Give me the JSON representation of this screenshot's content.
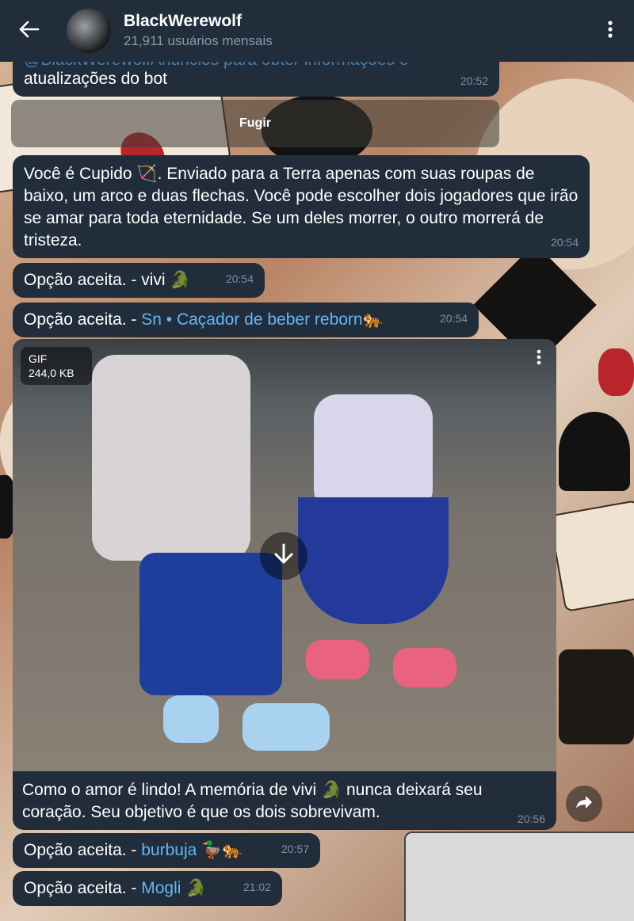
{
  "header": {
    "back_icon": "back-arrow-icon",
    "title": "BlackWerewolf",
    "subtitle": "21,911 usuários mensais",
    "menu_icon": "more-vertical-icon"
  },
  "messages": [
    {
      "id": "m0",
      "text_partial": "@BlackWerewolfAnuncios para obter informações e",
      "text": "atualizações do bot",
      "time": "20:52"
    },
    {
      "id": "fugir",
      "button": "Fugir"
    },
    {
      "id": "m1",
      "text": "Você é Cupido 🏹. Enviado para a Terra apenas com suas roupas de baixo, um arco e duas flechas. Você pode escolher dois jogadores que irão se amar para toda eternidade. Se um deles morrer, o outro morrerá de tristeza.",
      "time": "20:54"
    },
    {
      "id": "m2",
      "prefix": "Opção aceita. - ",
      "name": "vivi 🐊",
      "time": "20:54"
    },
    {
      "id": "m3",
      "prefix": "Opção aceita. - ",
      "name": "Sn • Caçador de beber reborn🐅",
      "time": "20:54"
    },
    {
      "id": "m4",
      "gif_label": "GIF",
      "gif_size": "244,0 KB",
      "caption": "Como o amor é lindo! A memória de vivi 🐊 nunca deixará seu coração. Seu objetivo é que os dois sobrevivam.",
      "time": "20:56"
    },
    {
      "id": "m5",
      "prefix": "Opção aceita. - ",
      "name": "burbuja 🦆🐅",
      "time": "20:57"
    },
    {
      "id": "m6",
      "prefix": "Opção aceita. - ",
      "name": "Mogli 🐊",
      "time": "21:02"
    }
  ],
  "colors": {
    "header_bg": "#212d3b",
    "bubble_bg": "#212d3b",
    "link": "#64b5f6",
    "time": "#7f8e9e"
  }
}
